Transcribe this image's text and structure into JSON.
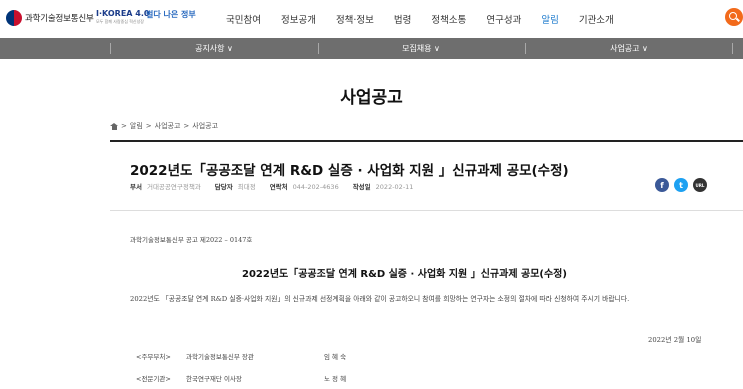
{
  "header": {
    "ministry_name": "과학기술정보통신부",
    "ikorea_label": "I·KOREA 4.0",
    "ikorea_sub": "모두 함께 사람중심 혁신성장",
    "bada_label": "벌다 나은 정부",
    "nav": [
      "국민참여",
      "정보공개",
      "정책·정보",
      "법령",
      "정책소통",
      "연구성과",
      "알림",
      "기관소개"
    ],
    "active_nav": "알림",
    "accent_color": "#1e7bcd",
    "search_color": "#f26a1b"
  },
  "subnav": {
    "items": [
      "공지사항 ∨",
      "모집채용 ∨",
      "사업공고 ∨"
    ]
  },
  "page_title": "사업공고",
  "breadcrumb": {
    "items": [
      "알림",
      "사업공고",
      "사업공고"
    ],
    "sep": ">"
  },
  "post": {
    "title": "2022년도「공공조달 연계 R&D 실증 · 사업화 지원 」신규과제 공모(수정)",
    "meta": [
      {
        "label": "부서",
        "value": "거대공공연구정책과"
      },
      {
        "label": "담당자",
        "value": "최대정"
      },
      {
        "label": "연락처",
        "value": "044-202-4636"
      },
      {
        "label": "작성일",
        "value": "2022-02-11"
      }
    ],
    "share": [
      "f",
      "t",
      "URL"
    ]
  },
  "body": {
    "doc_number": "과학기술정보통신부 공고 제2022 – 0147호",
    "doc_title": "2022년도「공공조달 연계 R&D 실증 · 사업화 지원 」신규과제 공모(수정)",
    "paragraph": "2022년도 「공공조달 연계 R&D 실증·사업화 지원」의 신규과제 선정계획을 아래와 같이 공고하오니 참여를 희망하는 연구자는 소정의 절차에 따라 신청하여 주시기 바랍니다.",
    "date": "2022년 2월 10일",
    "signers": [
      {
        "role": "<주무부처>",
        "org": "과학기술정보통신부 장관",
        "name": "임 혜 숙"
      },
      {
        "role": "<전문기관>",
        "org": "한국연구재단 이사장",
        "name": "노 정 혜"
      }
    ]
  }
}
